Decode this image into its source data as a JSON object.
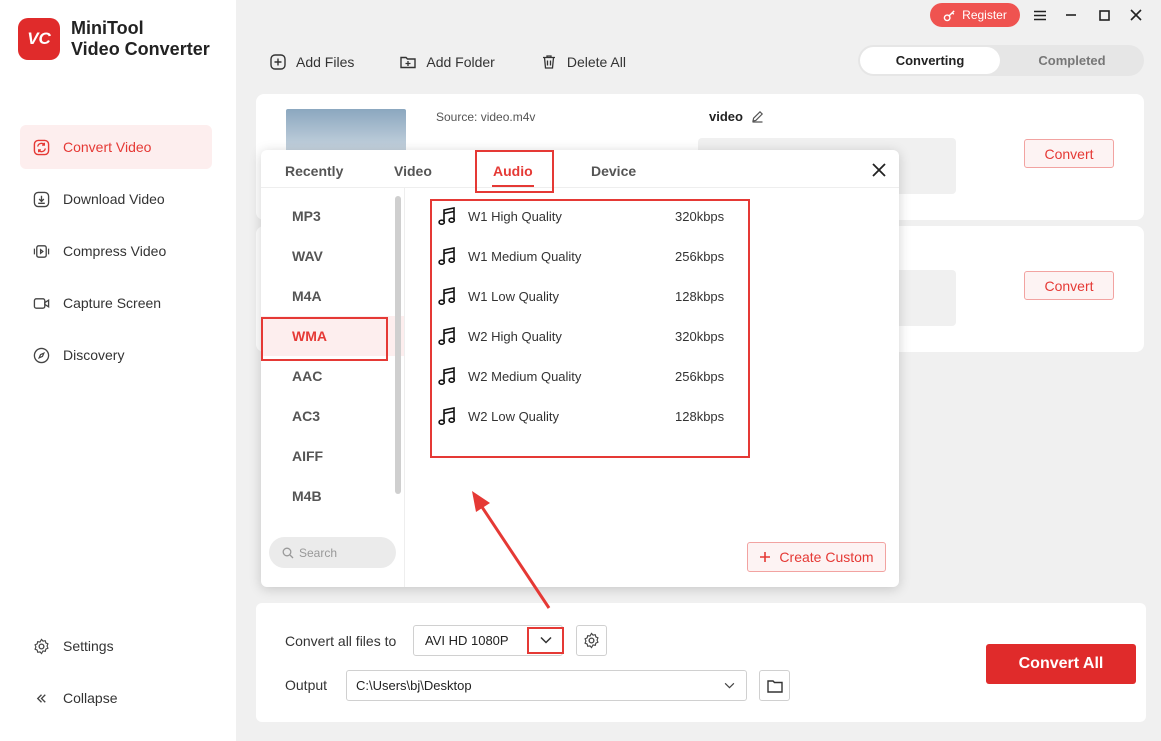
{
  "app": {
    "logo_mark": "VC",
    "title_line1": "MiniTool",
    "title_line2": "Video Converter"
  },
  "titlebar": {
    "register_label": "Register"
  },
  "sidebar": {
    "items": [
      {
        "label": "Convert Video",
        "icon": "convert-icon",
        "active": true
      },
      {
        "label": "Download Video",
        "icon": "download-icon"
      },
      {
        "label": "Compress Video",
        "icon": "compress-icon"
      },
      {
        "label": "Capture Screen",
        "icon": "camera-icon"
      },
      {
        "label": "Discovery",
        "icon": "compass-icon"
      }
    ],
    "settings_label": "Settings",
    "collapse_label": "Collapse"
  },
  "toolbar": {
    "add_files": "Add Files",
    "add_folder": "Add Folder",
    "delete_all": "Delete All"
  },
  "tabs": {
    "converting": "Converting",
    "completed": "Completed"
  },
  "files": [
    {
      "source": "Source:  video.m4v",
      "target_name": "video",
      "convert_label": "Convert"
    },
    {
      "convert_label": "Convert"
    }
  ],
  "popup": {
    "tabs": [
      "Recently",
      "Video",
      "Audio",
      "Device"
    ],
    "active_tab": "Audio",
    "formats": [
      "MP3",
      "WAV",
      "M4A",
      "WMA",
      "AAC",
      "AC3",
      "AIFF",
      "M4B"
    ],
    "active_format": "WMA",
    "search_placeholder": "Search",
    "qualities": [
      {
        "name": "W1 High Quality",
        "bitrate": "320kbps"
      },
      {
        "name": "W1 Medium Quality",
        "bitrate": "256kbps"
      },
      {
        "name": "W1 Low Quality",
        "bitrate": "128kbps"
      },
      {
        "name": "W2 High Quality",
        "bitrate": "320kbps"
      },
      {
        "name": "W2 Medium Quality",
        "bitrate": "256kbps"
      },
      {
        "name": "W2 Low Quality",
        "bitrate": "128kbps"
      }
    ],
    "create_custom": "Create Custom"
  },
  "bottom": {
    "convert_all_files_to": "Convert all files to",
    "format_value": "AVI HD 1080P",
    "output_label": "Output",
    "output_path": "C:\\Users\\bj\\Desktop",
    "convert_all": "Convert All"
  },
  "colors": {
    "accent": "#e53935",
    "brand": "#e02b2b"
  }
}
